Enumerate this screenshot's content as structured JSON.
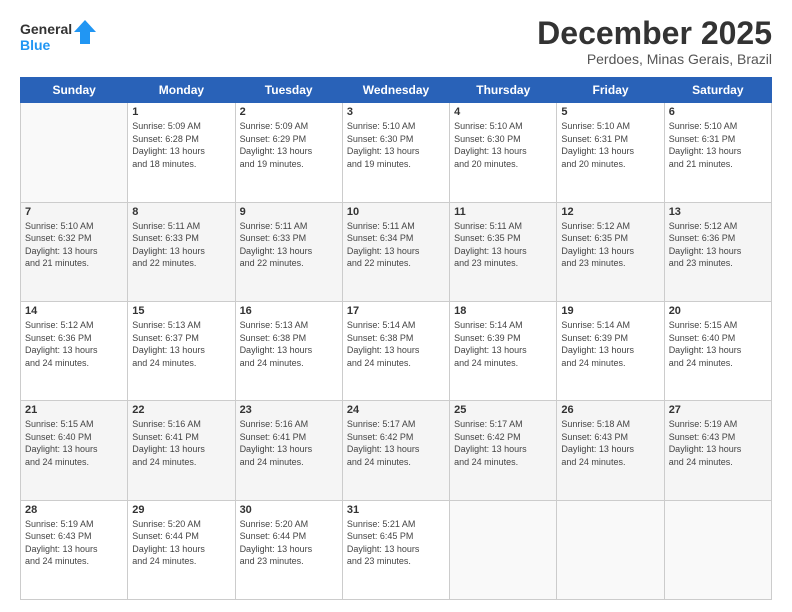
{
  "logo": {
    "line1": "General",
    "line2": "Blue"
  },
  "title": "December 2025",
  "location": "Perdoes, Minas Gerais, Brazil",
  "days_header": [
    "Sunday",
    "Monday",
    "Tuesday",
    "Wednesday",
    "Thursday",
    "Friday",
    "Saturday"
  ],
  "weeks": [
    [
      {
        "day": "",
        "info": ""
      },
      {
        "day": "1",
        "info": "Sunrise: 5:09 AM\nSunset: 6:28 PM\nDaylight: 13 hours\nand 18 minutes."
      },
      {
        "day": "2",
        "info": "Sunrise: 5:09 AM\nSunset: 6:29 PM\nDaylight: 13 hours\nand 19 minutes."
      },
      {
        "day": "3",
        "info": "Sunrise: 5:10 AM\nSunset: 6:30 PM\nDaylight: 13 hours\nand 19 minutes."
      },
      {
        "day": "4",
        "info": "Sunrise: 5:10 AM\nSunset: 6:30 PM\nDaylight: 13 hours\nand 20 minutes."
      },
      {
        "day": "5",
        "info": "Sunrise: 5:10 AM\nSunset: 6:31 PM\nDaylight: 13 hours\nand 20 minutes."
      },
      {
        "day": "6",
        "info": "Sunrise: 5:10 AM\nSunset: 6:31 PM\nDaylight: 13 hours\nand 21 minutes."
      }
    ],
    [
      {
        "day": "7",
        "info": "Sunrise: 5:10 AM\nSunset: 6:32 PM\nDaylight: 13 hours\nand 21 minutes."
      },
      {
        "day": "8",
        "info": "Sunrise: 5:11 AM\nSunset: 6:33 PM\nDaylight: 13 hours\nand 22 minutes."
      },
      {
        "day": "9",
        "info": "Sunrise: 5:11 AM\nSunset: 6:33 PM\nDaylight: 13 hours\nand 22 minutes."
      },
      {
        "day": "10",
        "info": "Sunrise: 5:11 AM\nSunset: 6:34 PM\nDaylight: 13 hours\nand 22 minutes."
      },
      {
        "day": "11",
        "info": "Sunrise: 5:11 AM\nSunset: 6:35 PM\nDaylight: 13 hours\nand 23 minutes."
      },
      {
        "day": "12",
        "info": "Sunrise: 5:12 AM\nSunset: 6:35 PM\nDaylight: 13 hours\nand 23 minutes."
      },
      {
        "day": "13",
        "info": "Sunrise: 5:12 AM\nSunset: 6:36 PM\nDaylight: 13 hours\nand 23 minutes."
      }
    ],
    [
      {
        "day": "14",
        "info": "Sunrise: 5:12 AM\nSunset: 6:36 PM\nDaylight: 13 hours\nand 24 minutes."
      },
      {
        "day": "15",
        "info": "Sunrise: 5:13 AM\nSunset: 6:37 PM\nDaylight: 13 hours\nand 24 minutes."
      },
      {
        "day": "16",
        "info": "Sunrise: 5:13 AM\nSunset: 6:38 PM\nDaylight: 13 hours\nand 24 minutes."
      },
      {
        "day": "17",
        "info": "Sunrise: 5:14 AM\nSunset: 6:38 PM\nDaylight: 13 hours\nand 24 minutes."
      },
      {
        "day": "18",
        "info": "Sunrise: 5:14 AM\nSunset: 6:39 PM\nDaylight: 13 hours\nand 24 minutes."
      },
      {
        "day": "19",
        "info": "Sunrise: 5:14 AM\nSunset: 6:39 PM\nDaylight: 13 hours\nand 24 minutes."
      },
      {
        "day": "20",
        "info": "Sunrise: 5:15 AM\nSunset: 6:40 PM\nDaylight: 13 hours\nand 24 minutes."
      }
    ],
    [
      {
        "day": "21",
        "info": "Sunrise: 5:15 AM\nSunset: 6:40 PM\nDaylight: 13 hours\nand 24 minutes."
      },
      {
        "day": "22",
        "info": "Sunrise: 5:16 AM\nSunset: 6:41 PM\nDaylight: 13 hours\nand 24 minutes."
      },
      {
        "day": "23",
        "info": "Sunrise: 5:16 AM\nSunset: 6:41 PM\nDaylight: 13 hours\nand 24 minutes."
      },
      {
        "day": "24",
        "info": "Sunrise: 5:17 AM\nSunset: 6:42 PM\nDaylight: 13 hours\nand 24 minutes."
      },
      {
        "day": "25",
        "info": "Sunrise: 5:17 AM\nSunset: 6:42 PM\nDaylight: 13 hours\nand 24 minutes."
      },
      {
        "day": "26",
        "info": "Sunrise: 5:18 AM\nSunset: 6:43 PM\nDaylight: 13 hours\nand 24 minutes."
      },
      {
        "day": "27",
        "info": "Sunrise: 5:19 AM\nSunset: 6:43 PM\nDaylight: 13 hours\nand 24 minutes."
      }
    ],
    [
      {
        "day": "28",
        "info": "Sunrise: 5:19 AM\nSunset: 6:43 PM\nDaylight: 13 hours\nand 24 minutes."
      },
      {
        "day": "29",
        "info": "Sunrise: 5:20 AM\nSunset: 6:44 PM\nDaylight: 13 hours\nand 24 minutes."
      },
      {
        "day": "30",
        "info": "Sunrise: 5:20 AM\nSunset: 6:44 PM\nDaylight: 13 hours\nand 23 minutes."
      },
      {
        "day": "31",
        "info": "Sunrise: 5:21 AM\nSunset: 6:45 PM\nDaylight: 13 hours\nand 23 minutes."
      },
      {
        "day": "",
        "info": ""
      },
      {
        "day": "",
        "info": ""
      },
      {
        "day": "",
        "info": ""
      }
    ]
  ]
}
